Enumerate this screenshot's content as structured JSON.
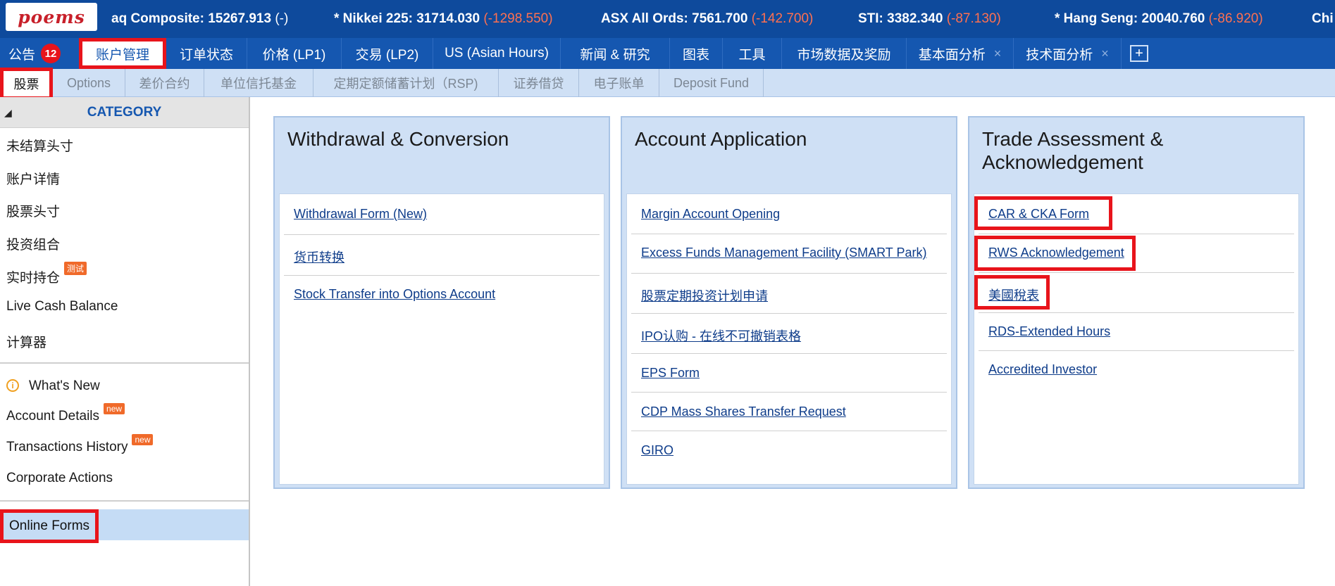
{
  "logo": {
    "text": "poems"
  },
  "ticker": [
    {
      "name": "aq Composite: 15267.913",
      "change": "(-)"
    },
    {
      "name": "* Nikkei 225: 31714.030",
      "change": "(-1298.550)"
    },
    {
      "name": "ASX All Ords: 7561.700",
      "change": "(-142.700)"
    },
    {
      "name": "STI: 3382.340",
      "change": "(-87.130)"
    },
    {
      "name": "* Hang Seng: 20040.760",
      "change": "(-86.920)"
    },
    {
      "name": "Chi",
      "change": ""
    }
  ],
  "nav": {
    "announcement": "公告",
    "badge": "12",
    "items": [
      "账户管理",
      "订单状态",
      "价格 (LP1)",
      "交易 (LP2)",
      "US (Asian Hours)",
      "新闻 & 研究",
      "图表",
      "工具",
      "市场数据及奖励",
      "基本面分析",
      "技术面分析"
    ],
    "close_glyph": "×",
    "plus": "+"
  },
  "subtabs": [
    "股票",
    "Options",
    "差价合约",
    "单位信托基金",
    "定期定额储蓄计划（RSP)",
    "证券借贷",
    "电子账单",
    "Deposit Fund"
  ],
  "sidebar": {
    "category": "CATEGORY",
    "collapse_glyph": "◢",
    "group1": [
      "未结算头寸",
      "账户详情",
      "股票头寸",
      "投资组合",
      "实时持仓",
      "Live Cash Balance",
      "计算器"
    ],
    "test_tag": "测试",
    "group2": [
      "What's New",
      "Account Details",
      "Transactions History",
      "Corporate Actions"
    ],
    "new_tag": "new",
    "info_glyph": "i",
    "online_forms": "Online Forms"
  },
  "cards": [
    {
      "title": "Withdrawal & Conversion",
      "links": [
        "Withdrawal Form (New)",
        "货币转换",
        "Stock Transfer into Options Account"
      ]
    },
    {
      "title": "Account Application",
      "links": [
        "Margin Account Opening",
        "Excess Funds Management Facility (SMART Park)",
        "股票定期投资计划申请",
        "IPO认购 - 在线不可撤销表格",
        "EPS Form",
        "CDP Mass Shares Transfer Request",
        "GIRO"
      ]
    },
    {
      "title": "Trade Assessment & Acknowledgement",
      "links": [
        "CAR & CKA Form",
        "RWS Acknowledgement",
        "美國稅表",
        "RDS-Extended Hours",
        "Accredited Investor"
      ]
    }
  ],
  "colors": {
    "nav_bg": "#1557b0",
    "ticker_bg": "#0e4a9c",
    "highlight": "#e8141b",
    "card_bg": "#cfe0f5",
    "negative": "#ff7050"
  }
}
